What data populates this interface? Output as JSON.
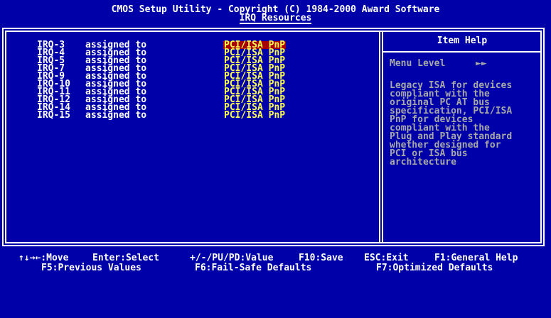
{
  "header": {
    "title": "CMOS Setup Utility - Copyright (C) 1984-2000 Award Software",
    "subtitle": "IRQ Resources"
  },
  "irqs": [
    {
      "label": "IRQ-3",
      "assigned": "assigned to",
      "value": "PCI/ISA PnP",
      "selected": true
    },
    {
      "label": "IRQ-4",
      "assigned": "assigned to",
      "value": "PCI/ISA PnP",
      "selected": false
    },
    {
      "label": "IRQ-5",
      "assigned": "assigned to",
      "value": "PCI/ISA PnP",
      "selected": false
    },
    {
      "label": "IRQ-7",
      "assigned": "assigned to",
      "value": "PCI/ISA PnP",
      "selected": false
    },
    {
      "label": "IRQ-9",
      "assigned": "assigned to",
      "value": "PCI/ISA PnP",
      "selected": false
    },
    {
      "label": "IRQ-10",
      "assigned": "assigned to",
      "value": "PCI/ISA PnP",
      "selected": false
    },
    {
      "label": "IRQ-11",
      "assigned": "assigned to",
      "value": "PCI/ISA PnP",
      "selected": false
    },
    {
      "label": "IRQ-12",
      "assigned": "assigned to",
      "value": "PCI/ISA PnP",
      "selected": false
    },
    {
      "label": "IRQ-14",
      "assigned": "assigned to",
      "value": "PCI/ISA PnP",
      "selected": false
    },
    {
      "label": "IRQ-15",
      "assigned": "assigned to",
      "value": "PCI/ISA PnP",
      "selected": false
    }
  ],
  "help": {
    "title": "Item Help",
    "menu_level_label": "Menu Level",
    "menu_level_arrows": "►►",
    "lines": [
      "Legacy ISA for devices",
      "compliant with the",
      "original PC AT bus",
      "specification, PCI/ISA",
      "PnP for devices",
      "compliant with the",
      "Plug and Play standard",
      "whether designed for",
      "PCI or ISA bus",
      "architecture"
    ]
  },
  "footer": {
    "move": "↑↓→←:Move",
    "enter": "Enter:Select",
    "value": "+/-/PU/PD:Value",
    "save": "F10:Save",
    "exit": "ESC:Exit",
    "general_help": "F1:General Help",
    "previous": "F5:Previous Values",
    "failsafe": "F6:Fail-Safe Defaults",
    "optimized": "F7:Optimized Defaults"
  },
  "colors": {
    "background": "#0000a8",
    "text": "#ffffff",
    "value": "#ffff54",
    "selected_bg": "#a80000",
    "help_text": "#a8a8a8"
  }
}
